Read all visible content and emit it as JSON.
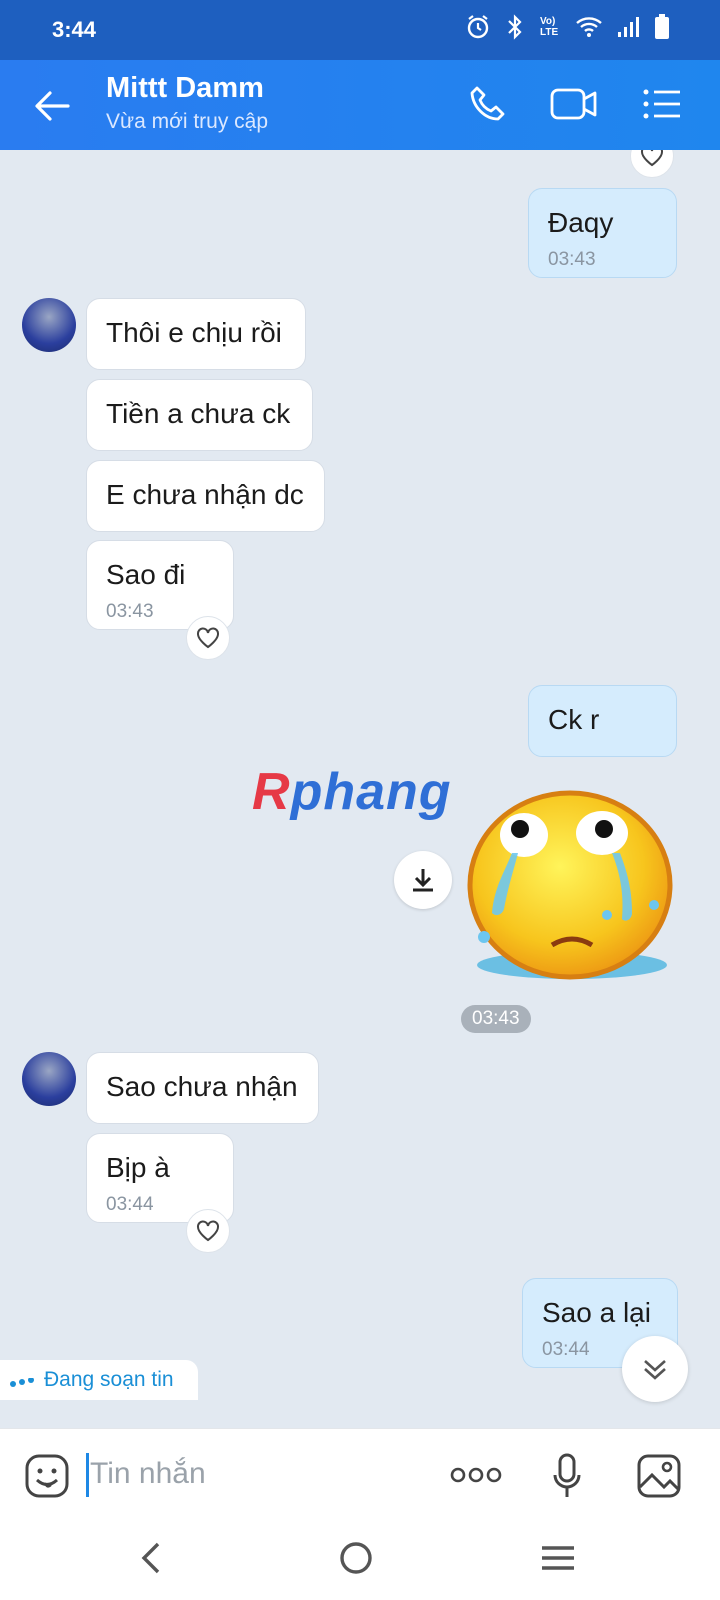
{
  "status_bar": {
    "time": "3:44",
    "icons": [
      "alarm-icon",
      "bluetooth-icon",
      "volte-icon",
      "wifi-icon",
      "signal-icon",
      "battery-icon"
    ],
    "volte_label": "Vo) LTE"
  },
  "header": {
    "contact_name": "Mittt Damm",
    "status": "Vừa mới truy cập",
    "icons": [
      "back-arrow-icon",
      "phone-icon",
      "video-call-icon",
      "menu-list-icon"
    ]
  },
  "messages": [
    {
      "side": "out",
      "text": "Đaqy",
      "time": "03:43"
    },
    {
      "side": "in",
      "text": "Thôi e chịu rồi"
    },
    {
      "side": "in",
      "text": "Tiền a chưa ck"
    },
    {
      "side": "in",
      "text": "E chưa nhận dc"
    },
    {
      "side": "in",
      "text": "Sao đi",
      "time": "03:43"
    },
    {
      "side": "out",
      "text": "Ck r"
    },
    {
      "side": "out",
      "type": "sticker",
      "sticker": "crying-face-sticker",
      "time": "03:43"
    },
    {
      "side": "in",
      "text": "Sao chưa nhận"
    },
    {
      "side": "in",
      "text": "Bịp à",
      "time": "03:44"
    },
    {
      "side": "out",
      "text": "Sao a lại",
      "time": "03:44"
    }
  ],
  "watermark": "Rphang",
  "typing_indicator": "Đang soạn tin",
  "input": {
    "placeholder": "Tin nhắn",
    "icons": [
      "emoji-icon",
      "more-icon",
      "microphone-icon",
      "image-icon"
    ]
  },
  "colors": {
    "header": "#1f86ee",
    "status_bar": "#1e5fbf",
    "outgoing_bubble": "#d5ecfd",
    "chat_bg": "#e2e9f1",
    "accent": "#1a8fd6"
  }
}
